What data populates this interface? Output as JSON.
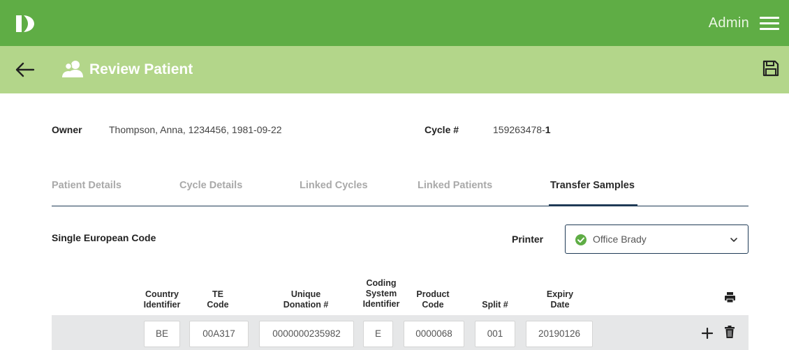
{
  "app": {
    "user_label": "Admin",
    "brand_color": "#5fad45",
    "subheader_color": "#b3d68a"
  },
  "page": {
    "title": "Review Patient"
  },
  "owner": {
    "label": "Owner",
    "value": "Thompson, Anna, 1234456, 1981-09-22"
  },
  "cycle": {
    "label": "Cycle #",
    "number": "159263478-",
    "suffix": "1"
  },
  "tabs": [
    {
      "label": "Patient Details",
      "active": false
    },
    {
      "label": "Cycle Details",
      "active": false
    },
    {
      "label": "Linked Cycles",
      "active": false
    },
    {
      "label": "Linked Patients",
      "active": false
    },
    {
      "label": "Transfer Samples",
      "active": true
    }
  ],
  "section": {
    "title": "Single European Code"
  },
  "printer": {
    "label": "Printer",
    "selected": "Office Brady",
    "status_icon": "check-circle-icon"
  },
  "columns": [
    {
      "line1": "Country",
      "line2": "Identifier",
      "line3": ""
    },
    {
      "line1": "TE",
      "line2": "Code",
      "line3": ""
    },
    {
      "line1": "Unique",
      "line2": "Donation #",
      "line3": ""
    },
    {
      "line1": "Coding",
      "line2": "System",
      "line3": "Identifier"
    },
    {
      "line1": "Product",
      "line2": "Code",
      "line3": ""
    },
    {
      "line1": "",
      "line2": "Split #",
      "line3": ""
    },
    {
      "line1": "Expiry",
      "line2": "Date",
      "line3": ""
    }
  ],
  "row": {
    "country_identifier": "BE",
    "te_code": "00A317",
    "unique_donation": "0000000235982",
    "coding_system": "E",
    "product_code": "0000068",
    "split": "001",
    "expiry_date": "20190126"
  }
}
